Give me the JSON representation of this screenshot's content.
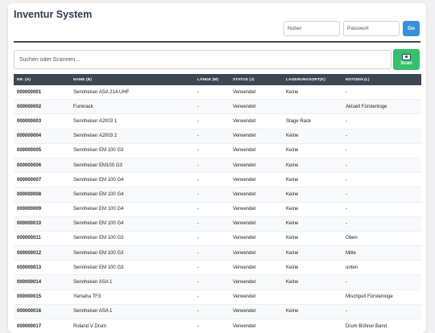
{
  "header": {
    "title": "Inventur System"
  },
  "login": {
    "user_placeholder": "Nuber",
    "password_placeholder": "Passwort",
    "go_label": "Go"
  },
  "search": {
    "placeholder": "Suchen oder Scannen...",
    "scan_label": "Scan"
  },
  "table": {
    "columns": [
      "NR. (A)",
      "NAME (B)",
      "LÄNGE (M)",
      "STATUS (J)",
      "LAGERUNGSORT(K)",
      "NOTIZEN (L)"
    ],
    "rows": [
      [
        "000000001",
        "Sennheiser ASA 214-UHF",
        "-",
        "Verwendet",
        "Keine",
        "-"
      ],
      [
        "000000002",
        "Funkrack",
        "-",
        "Verwendet",
        "",
        "Aktuell Fürstenloge"
      ],
      [
        "000000003",
        "Sennheiser A2003 1",
        "-",
        "Verwendet",
        "Stage Rack",
        "-"
      ],
      [
        "000000004",
        "Sennheiser A2003 2",
        "-",
        "Verwendet",
        "Keine",
        "-"
      ],
      [
        "000000005",
        "Sennheiser EM 100 G3",
        "-",
        "Verwendet",
        "Keine",
        "-"
      ],
      [
        "000000006",
        "Sennheiser EM100 G3",
        "-",
        "Verwendet",
        "Keine",
        "-"
      ],
      [
        "000000007",
        "Sennheiser EM 100 G4",
        "-",
        "Verwendet",
        "Keine",
        "-"
      ],
      [
        "000000008",
        "Sennheiser EM 100 G4",
        "-",
        "Verwendet",
        "Keine",
        "-"
      ],
      [
        "000000009",
        "Sennheiser EM 100 G4",
        "-",
        "Verwendet",
        "Keine",
        "-"
      ],
      [
        "000000010",
        "Sennheiser EM 100 G4",
        "-",
        "Verwendet",
        "Keine",
        "-"
      ],
      [
        "000000011",
        "Sennheiser EM 100 G3",
        "-",
        "Verwendet",
        "Keine",
        "Oben"
      ],
      [
        "000000012",
        "Sennheiser EM 100 G3",
        "-",
        "Verwendet",
        "Keine",
        "Mitte"
      ],
      [
        "000000013",
        "Sennheiser EM 100 G3",
        "-",
        "Verwendet",
        "Keine",
        "unten"
      ],
      [
        "000000014",
        "Sennheiser ASA 1",
        "-",
        "Verwendet",
        "Keine",
        "-"
      ],
      [
        "000000015",
        "Yamaha TF3",
        "-",
        "Verwendet",
        "",
        "Mischpult Fürstenloge"
      ],
      [
        "000000016",
        "Sennheiser ASA 1",
        "-",
        "Verwendet",
        "Keine",
        "-"
      ],
      [
        "000000017",
        "Roland V Drum",
        "-",
        "Verwendet",
        "",
        "Drum Bühne/ Band"
      ]
    ]
  },
  "colors": {
    "header_bg": "#3c4754",
    "go_button": "#3a8fd9",
    "scan_button": "#36c06a"
  },
  "icons": {
    "scan": "camera-icon"
  }
}
